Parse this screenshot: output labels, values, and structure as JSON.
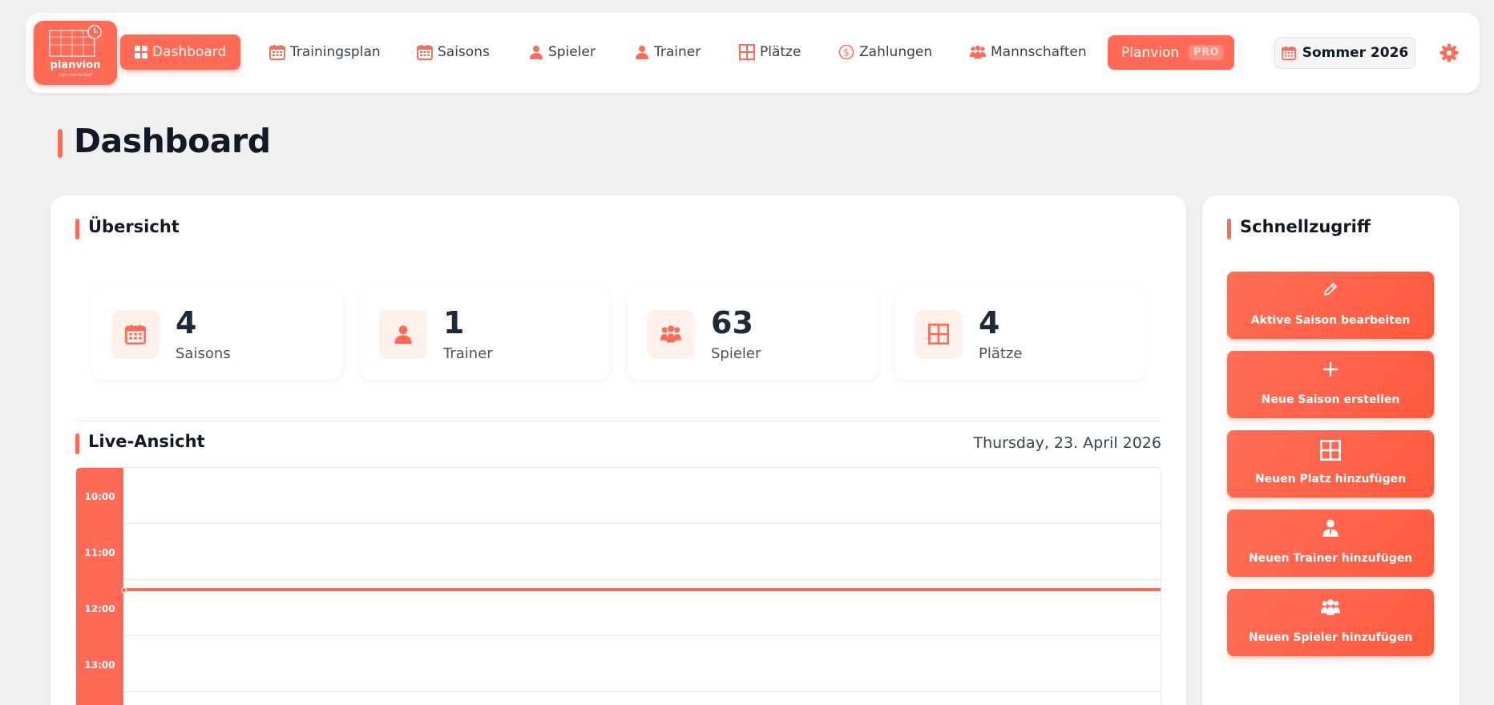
{
  "brand": {
    "name": "planvion",
    "tagline": "Plan und Aufstell"
  },
  "nav": {
    "items": [
      {
        "label": "Dashboard"
      },
      {
        "label": "Trainingsplan"
      },
      {
        "label": "Saisons"
      },
      {
        "label": "Spieler"
      },
      {
        "label": "Trainer"
      },
      {
        "label": "Plätze"
      },
      {
        "label": "Zahlungen"
      },
      {
        "label": "Mannschaften"
      }
    ],
    "pro": {
      "label": "Planvion",
      "badge": "PRO"
    },
    "season": {
      "label": "Sommer 2026"
    }
  },
  "page": {
    "title": "Dashboard"
  },
  "overview": {
    "title": "Übersicht",
    "stats": [
      {
        "value": "4",
        "label": "Saisons",
        "icon": "calendar-icon"
      },
      {
        "value": "1",
        "label": "Trainer",
        "icon": "person-icon"
      },
      {
        "value": "63",
        "label": "Spieler",
        "icon": "group-icon"
      },
      {
        "value": "4",
        "label": "Plätze",
        "icon": "grid-icon"
      }
    ]
  },
  "live": {
    "title": "Live-Ansicht",
    "date": "Thursday, 23. April 2026",
    "hours": [
      "10:00",
      "11:00",
      "12:00",
      "13:00"
    ]
  },
  "quick": {
    "title": "Schnellzugriff",
    "buttons": [
      {
        "label": "Aktive Saison bearbeiten",
        "icon": "pencil-icon"
      },
      {
        "label": "Neue Saison erstellen",
        "icon": "plus-icon"
      },
      {
        "label": "Neuen Platz hinzufügen",
        "icon": "grid-icon"
      },
      {
        "label": "Neuen Trainer hinzufügen",
        "icon": "trainer-icon"
      },
      {
        "label": "Neuen Spieler hinzufügen",
        "icon": "group-icon"
      }
    ]
  },
  "colors": {
    "accent": "#ff6b57",
    "accent_soft": "#fff0ec",
    "background": "#f0f0f0"
  }
}
